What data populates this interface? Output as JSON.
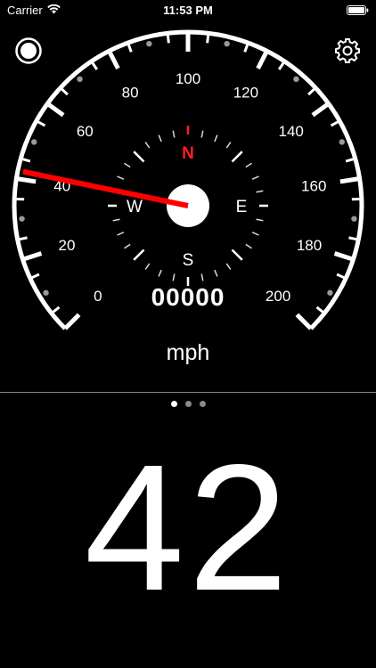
{
  "status_bar": {
    "carrier": "Carrier",
    "time": "11:53 PM"
  },
  "toolbar": {
    "record_icon": "record-icon",
    "settings_icon": "gear-icon"
  },
  "gauge": {
    "min": 0,
    "max": 200,
    "major_labels": [
      "0",
      "20",
      "40",
      "60",
      "80",
      "100",
      "120",
      "140",
      "160",
      "180",
      "200"
    ],
    "needle_value": 42,
    "needle_color": "#ff0000",
    "compass": {
      "north": "N",
      "east": "E",
      "south": "S",
      "west": "W",
      "north_color": "#ff2020"
    },
    "odometer": "00000",
    "unit": "mph"
  },
  "pager": {
    "count": 3,
    "active_index": 0
  },
  "digital": {
    "speed": "42"
  }
}
